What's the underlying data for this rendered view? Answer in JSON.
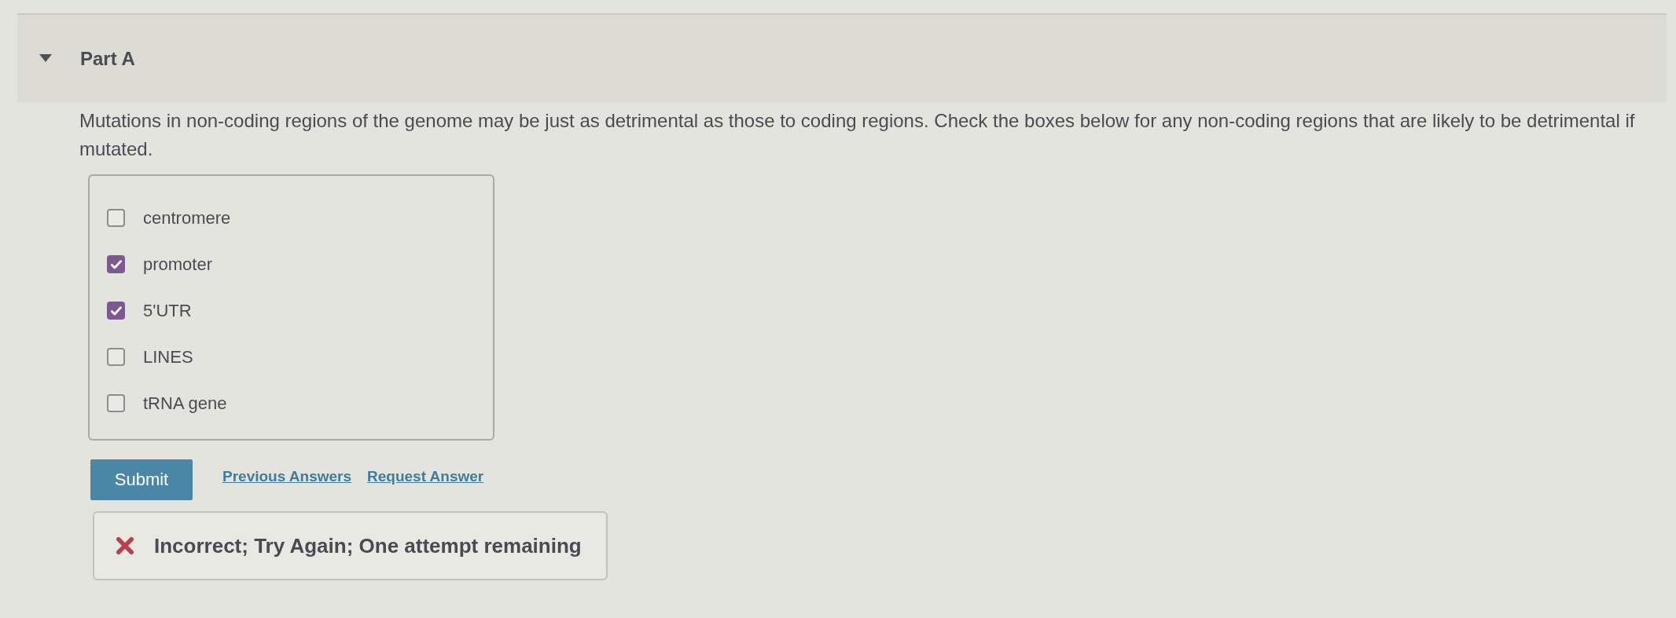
{
  "part": {
    "title": "Part A",
    "expanded": true
  },
  "question": "Mutations in non-coding regions of the genome may be just as detrimental as those to coding regions. Check the boxes below for any non-coding regions that are likely to be detrimental if mutated.",
  "options": [
    {
      "label": "centromere",
      "checked": false
    },
    {
      "label": "promoter",
      "checked": true
    },
    {
      "label": "5'UTR",
      "checked": true
    },
    {
      "label": "LINES",
      "checked": false
    },
    {
      "label": "tRNA gene",
      "checked": false
    }
  ],
  "actions": {
    "submit": "Submit",
    "links": [
      "Previous Answers",
      "Request Answer"
    ]
  },
  "feedback": {
    "correct": false,
    "message": "Incorrect; Try Again; One attempt remaining"
  }
}
